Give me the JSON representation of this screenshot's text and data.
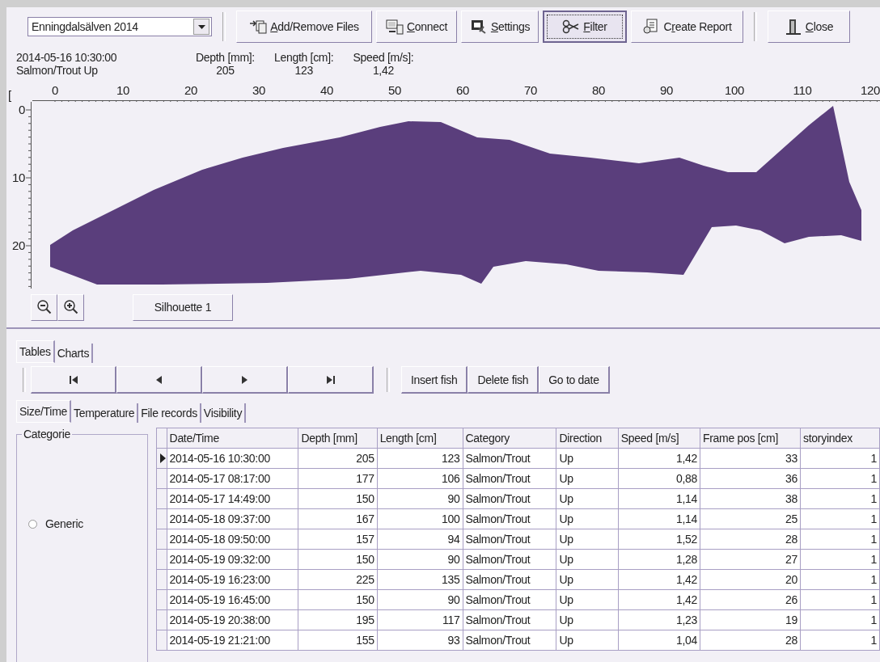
{
  "toolbar": {
    "river": {
      "value": "Enningdalsälven 2014"
    },
    "buttons": [
      {
        "label": "Add/Remove Files",
        "kind": "files",
        "selected": false
      },
      {
        "label": "Connect",
        "kind": "connect",
        "selected": false
      },
      {
        "label": "Settings",
        "kind": "settings",
        "selected": false
      },
      {
        "label": "Filter",
        "kind": "filter",
        "selected": true
      },
      {
        "label": "Create Report",
        "kind": "report",
        "selected": false
      },
      {
        "label": "Close",
        "kind": "close",
        "selected": false
      }
    ]
  },
  "fish_info": {
    "timestamp": "2014-05-16 10:30:00",
    "description": "Salmon/Trout Up",
    "fields": [
      {
        "label": "Depth [mm]:",
        "value": "205"
      },
      {
        "label": "Length [cm]:",
        "value": "123"
      },
      {
        "label": "Speed [m/s]:",
        "value": "1,42"
      }
    ]
  },
  "ruler": {
    "bracket": "[",
    "x_labels": [
      "0",
      "10",
      "20",
      "30",
      "40",
      "50",
      "60",
      "70",
      "80",
      "90",
      "100",
      "110",
      "120"
    ],
    "y_labels": [
      "0",
      "10",
      "20"
    ]
  },
  "silhouette_buttons": [
    {
      "label": "Silhouette 1"
    }
  ],
  "tabs": [
    {
      "label": "Tables",
      "selected": true
    },
    {
      "label": "Charts",
      "selected": false
    }
  ],
  "navigation": [
    {
      "kind": "first"
    },
    {
      "kind": "previous"
    },
    {
      "kind": "next"
    },
    {
      "kind": "last"
    }
  ],
  "actions": [
    "Insert fish",
    "Delete fish",
    "Go to date"
  ],
  "sub_tabs": [
    {
      "label": "Size/Time",
      "selected": true
    },
    {
      "label": "Temperature",
      "selected": false
    },
    {
      "label": "File records",
      "selected": false
    },
    {
      "label": "Visibility",
      "selected": false
    }
  ],
  "categorie": {
    "title": "Categorie",
    "options": [
      {
        "label": "Generic",
        "checked": false
      }
    ]
  },
  "table": {
    "columns": [
      "Date/Time",
      "Depth [mm]",
      "Length [cm]",
      "Category",
      "Direction",
      "Speed [m/s]",
      "Frame pos [cm]",
      "storyindex"
    ],
    "rows": [
      {
        "selected": true,
        "cells": [
          "2014-05-16 10:30:00",
          "205",
          "123",
          "Salmon/Trout",
          "Up",
          "1,42",
          "33",
          "1"
        ]
      },
      {
        "selected": false,
        "cells": [
          "2014-05-17 08:17:00",
          "177",
          "106",
          "Salmon/Trout",
          "Up",
          "0,88",
          "36",
          "1"
        ]
      },
      {
        "selected": false,
        "cells": [
          "2014-05-17 14:49:00",
          "150",
          "90",
          "Salmon/Trout",
          "Up",
          "1,14",
          "38",
          "1"
        ]
      },
      {
        "selected": false,
        "cells": [
          "2014-05-18 09:37:00",
          "167",
          "100",
          "Salmon/Trout",
          "Up",
          "1,14",
          "25",
          "1"
        ]
      },
      {
        "selected": false,
        "cells": [
          "2014-05-18 09:50:00",
          "157",
          "94",
          "Salmon/Trout",
          "Up",
          "1,52",
          "28",
          "1"
        ]
      },
      {
        "selected": false,
        "cells": [
          "2014-05-19 09:32:00",
          "150",
          "90",
          "Salmon/Trout",
          "Up",
          "1,28",
          "27",
          "1"
        ]
      },
      {
        "selected": false,
        "cells": [
          "2014-05-19 16:23:00",
          "225",
          "135",
          "Salmon/Trout",
          "Up",
          "1,42",
          "20",
          "1"
        ]
      },
      {
        "selected": false,
        "cells": [
          "2014-05-19 16:45:00",
          "150",
          "90",
          "Salmon/Trout",
          "Up",
          "1,42",
          "26",
          "1"
        ]
      },
      {
        "selected": false,
        "cells": [
          "2014-05-19 20:38:00",
          "195",
          "117",
          "Salmon/Trout",
          "Up",
          "1,23",
          "19",
          "1"
        ]
      },
      {
        "selected": false,
        "cells": [
          "2014-05-19 21:21:00",
          "155",
          "93",
          "Salmon/Trout",
          "Up",
          "1,04",
          "28",
          "1"
        ]
      }
    ]
  }
}
